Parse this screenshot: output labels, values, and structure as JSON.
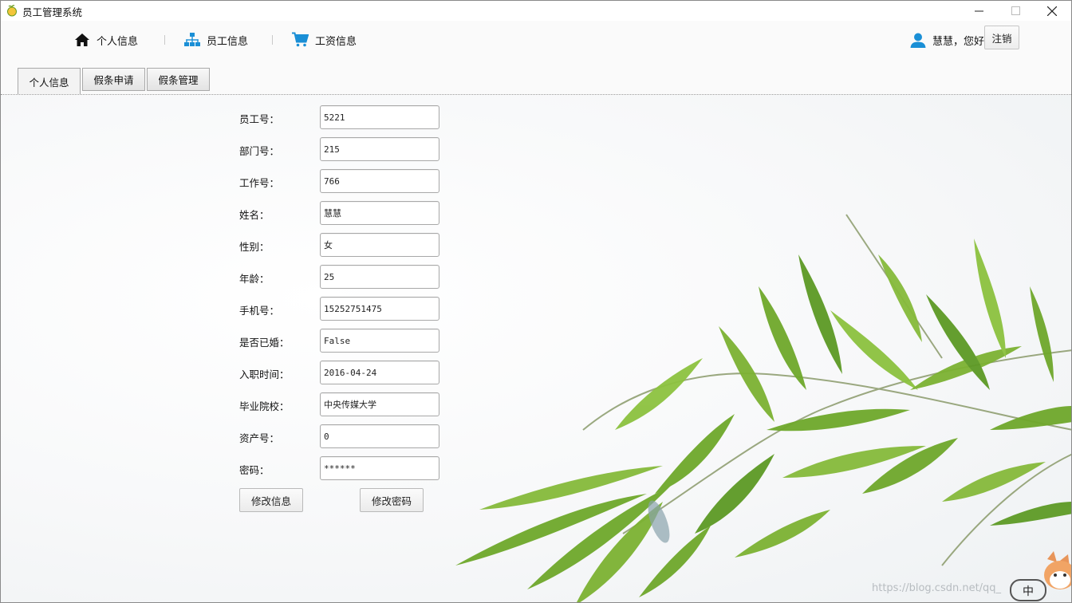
{
  "window": {
    "title": "员工管理系统",
    "minimize_glyph": "—",
    "maximize_glyph": "☐",
    "close_glyph": "✕"
  },
  "nav": {
    "personal": {
      "label": "个人信息",
      "icon": "home-icon"
    },
    "staff": {
      "label": "员工信息",
      "icon": "org-chart-icon"
    },
    "salary": {
      "label": "工资信息",
      "icon": "cart-icon"
    }
  },
  "user": {
    "greeting": "慧慧，您好",
    "icon": "user-icon",
    "logout_label": "注销"
  },
  "tabs": [
    {
      "label": "个人信息",
      "active": true
    },
    {
      "label": "假条申请",
      "active": false
    },
    {
      "label": "假条管理",
      "active": false
    }
  ],
  "form": {
    "fields": [
      {
        "label": "员工号：",
        "value": "5221"
      },
      {
        "label": "部门号：",
        "value": "215"
      },
      {
        "label": "工作号：",
        "value": "766"
      },
      {
        "label": "姓名：",
        "value": "慧慧"
      },
      {
        "label": "性别：",
        "value": "女"
      },
      {
        "label": "年龄：",
        "value": "25"
      },
      {
        "label": "手机号：",
        "value": "15252751475"
      },
      {
        "label": "是否已婚：",
        "value": "False"
      },
      {
        "label": "入职时间：",
        "value": "2016-04-24"
      },
      {
        "label": "毕业院校：",
        "value": "中央传媒大学"
      },
      {
        "label": "资产号：",
        "value": "0"
      },
      {
        "label": "密码：",
        "value": "******"
      }
    ],
    "edit_info_label": "修改信息",
    "edit_password_label": "修改密码"
  },
  "watermark": "https://blog.csdn.net/qq_",
  "mascot_badge": "中",
  "colors": {
    "accent_blue": "#1a8fd6",
    "nav_icon_dark": "#111111",
    "leaf_green": "#6fa82b"
  }
}
